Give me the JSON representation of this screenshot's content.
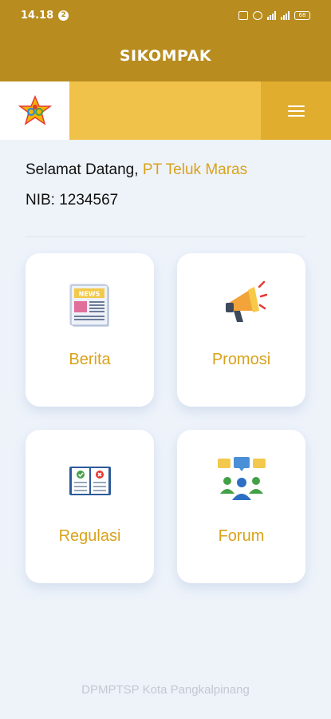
{
  "status_bar": {
    "time": "14.18",
    "notification_badge": "2",
    "battery": "68"
  },
  "header": {
    "title": "SIKOMPAK"
  },
  "greeting": {
    "prefix": "Selamat Datang, ",
    "company": "PT Teluk Maras",
    "nib": "NIB: 1234567"
  },
  "menu": {
    "items": [
      {
        "label": "Berita",
        "icon": "newspaper-icon"
      },
      {
        "label": "Promosi",
        "icon": "megaphone-icon"
      },
      {
        "label": "Regulasi",
        "icon": "regulation-book-icon"
      },
      {
        "label": "Forum",
        "icon": "forum-group-icon"
      }
    ]
  },
  "footer": {
    "text": "DPMPTSP Kota Pangkalpinang"
  },
  "colors": {
    "primary": "#b88c1f",
    "accent": "#f0c24a",
    "label": "#d9a21b",
    "background": "#eef3fa"
  }
}
